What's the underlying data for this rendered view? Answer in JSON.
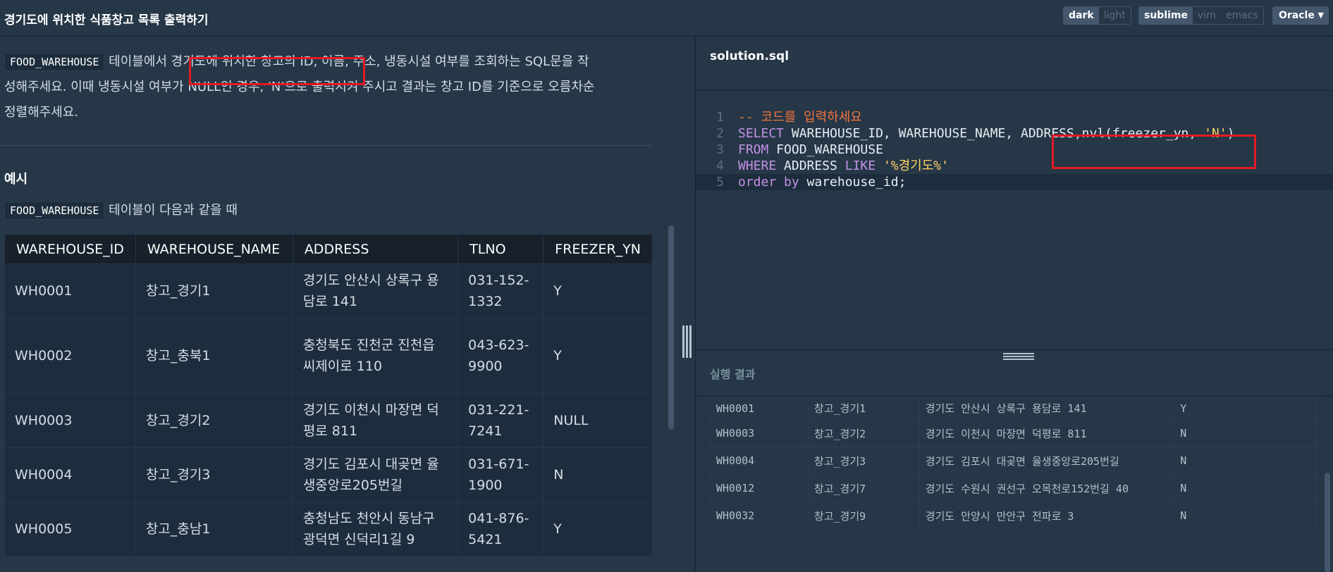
{
  "header": {
    "title": "경기도에 위치한 식품창고 목록 출력하기",
    "theme_options": [
      "dark",
      "light"
    ],
    "theme_active": "dark",
    "keymap_options": [
      "sublime",
      "vim",
      "emacs"
    ],
    "keymap_active": "sublime",
    "language": "Oracle"
  },
  "problem": {
    "table_chip": "FOOD_WAREHOUSE",
    "desc_1": " 테이블에서 경기도에 위치한 창고의 ID, 이름, 주소, 냉동시설 여부를 조회하는 SQL문을 작",
    "desc_2": "성해주세요. 이때 냉동시설 여부가 NULL인 경우, 'N'으로 출력시켜 주시고 결과는 창고 ID를 기준으로 오름차순",
    "desc_3": "정렬해주세요.",
    "example_heading": "예시",
    "example_chip": "FOOD_WAREHOUSE",
    "example_text": " 테이블이 다음과 같을 때",
    "columns": [
      "WAREHOUSE_ID",
      "WAREHOUSE_NAME",
      "ADDRESS",
      "TLNO",
      "FREEZER_YN"
    ],
    "rows": [
      [
        "WH0001",
        "창고_경기1",
        "경기도 안산시 상록구 용담로 141",
        "031-152-1332",
        "Y"
      ],
      [
        "WH0002",
        "창고_충북1",
        "충청북도 진천군 진천읍 씨제이로 110",
        "043-623-9900",
        "Y"
      ],
      [
        "WH0003",
        "창고_경기2",
        "경기도 이천시 마장면 덕평로 811",
        "031-221-7241",
        "NULL"
      ],
      [
        "WH0004",
        "창고_경기3",
        "경기도 김포시 대곶면 율생중앙로205번길",
        "031-671-1900",
        "N"
      ],
      [
        "WH0005",
        "창고_충남1",
        "충청남도 천안시 동남구 광덕면 신덕리1길 9",
        "041-876-5421",
        "Y"
      ]
    ]
  },
  "editor": {
    "filename": "solution.sql",
    "line_numbers": [
      "1",
      "2",
      "3",
      "4",
      "5"
    ],
    "l1": "-- 코드를 입력하세요",
    "l2_kw": "SELECT",
    "l2_a": " WAREHOUSE_ID, WAREHOUSE_NAME, ADDRESS,nvl(freezer_yn, ",
    "l2_str": "'N'",
    "l2_b": ")",
    "l3_kw": "FROM",
    "l3_a": " FOOD_WAREHOUSE",
    "l4_kw": "WHERE",
    "l4_a": " ADDRESS ",
    "l4_kw2": "LIKE",
    "l4_sp": " ",
    "l4_str": "'%경기도%'",
    "l5_kw": "order by",
    "l5_a": " warehouse_id;"
  },
  "result": {
    "heading": "실행 결과",
    "rows": [
      [
        "WH0001",
        "창고_경기1",
        "경기도 안산시 상록구 용담로 141",
        "Y"
      ],
      [
        "WH0003",
        "창고_경기2",
        "경기도 이천시 마장면 덕평로 811",
        "N"
      ],
      [
        "WH0004",
        "창고_경기3",
        "경기도 김포시 대곶면 율생중앙로205번길",
        "N"
      ],
      [
        "WH0012",
        "창고_경기7",
        "경기도 수원시 권선구 오목천로152번길 40",
        "N"
      ],
      [
        "WH0032",
        "창고_경기9",
        "경기도 안양시 만안구 전파로 3",
        "N"
      ]
    ]
  },
  "colors": {
    "background": "#263747",
    "highlight_box": "#e21b23",
    "keyword": "#c391e6",
    "comment": "#f3753c",
    "string": "#ffd166"
  }
}
